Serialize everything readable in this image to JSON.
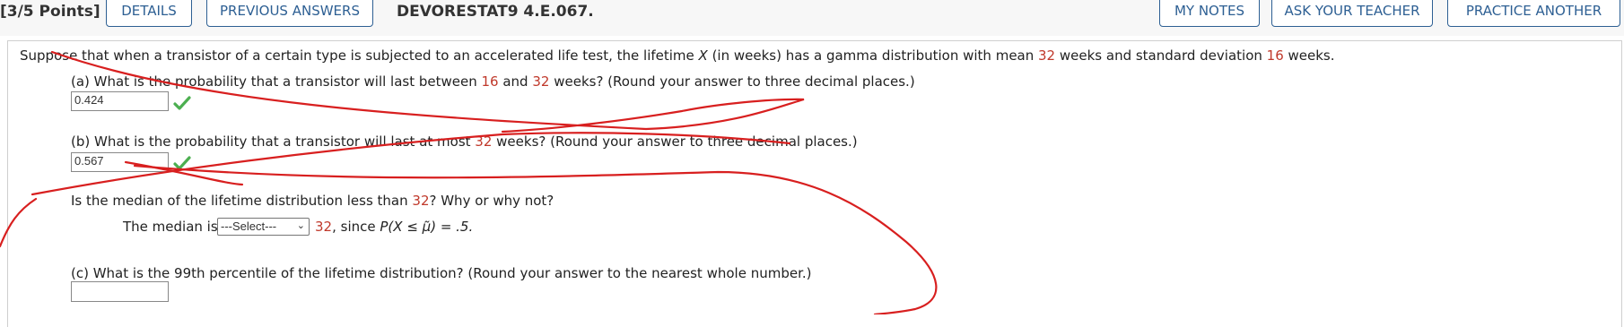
{
  "header": {
    "points": "[3/5 Points]",
    "details_label": "DETAILS",
    "previous_answers_label": "PREVIOUS ANSWERS",
    "problem_id": "DEVORESTAT9 4.E.067.",
    "my_notes_label": "MY NOTES",
    "ask_teacher_label": "ASK YOUR TEACHER",
    "practice_another_label": "PRACTICE ANOTHER"
  },
  "question": {
    "intro_a": "Suppose that when a transistor of a certain type is subjected to an accelerated life test, the lifetime ",
    "intro_var": "X",
    "intro_b": " (in weeks) has a gamma distribution with mean ",
    "mean": "32",
    "intro_c": " weeks and standard deviation ",
    "sd": "16",
    "intro_d": " weeks."
  },
  "part_a": {
    "text_1": "(a) What is the probability that a transistor will last between ",
    "low": "16",
    "text_2": " and ",
    "high": "32",
    "text_3": " weeks? (Round your answer to three decimal places.)",
    "answer": "0.424",
    "status": "correct"
  },
  "part_b": {
    "text_1": "(b) What is the probability that a transistor will last at most ",
    "value": "32",
    "text_2": " weeks? (Round your answer to three decimal places.)",
    "answer": "0.567",
    "status": "correct"
  },
  "median": {
    "question_1": "Is the median of the lifetime distribution less than ",
    "value": "32",
    "question_2": "? Why or why not?",
    "prefix": "The median is",
    "select_value": "---Select---",
    "compare_value": "32",
    "suffix_1": ", since ",
    "suffix_2": "P(X ≤ μ̃) = .5."
  },
  "part_c": {
    "text": "(c) What is the 99th percentile of the lifetime distribution? (Round your answer to the nearest whole number.)",
    "answer": ""
  },
  "colors": {
    "accent": "#2d5f93",
    "highlight_red": "#c0392b",
    "check_green": "#4caf50",
    "ink": "#d81f1f"
  }
}
